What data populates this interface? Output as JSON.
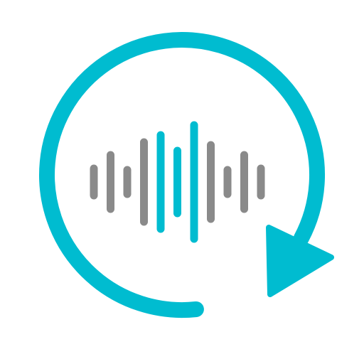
{
  "icon": {
    "name": "replay-audio-icon",
    "colors": {
      "background": "#ffffff",
      "accent": "#00bcd0",
      "muted": "#8a8a8a"
    },
    "waveform_bars": [
      {
        "level": 0.19,
        "color": "muted"
      },
      {
        "level": 0.38,
        "color": "muted"
      },
      {
        "level": 0.17,
        "color": "muted"
      },
      {
        "level": 0.56,
        "color": "muted"
      },
      {
        "level": 0.66,
        "color": "accent"
      },
      {
        "level": 0.44,
        "color": "accent"
      },
      {
        "level": 0.8,
        "color": "accent"
      },
      {
        "level": 0.52,
        "color": "muted"
      },
      {
        "level": 0.17,
        "color": "muted"
      },
      {
        "level": 0.38,
        "color": "muted"
      },
      {
        "level": 0.19,
        "color": "muted"
      }
    ]
  }
}
